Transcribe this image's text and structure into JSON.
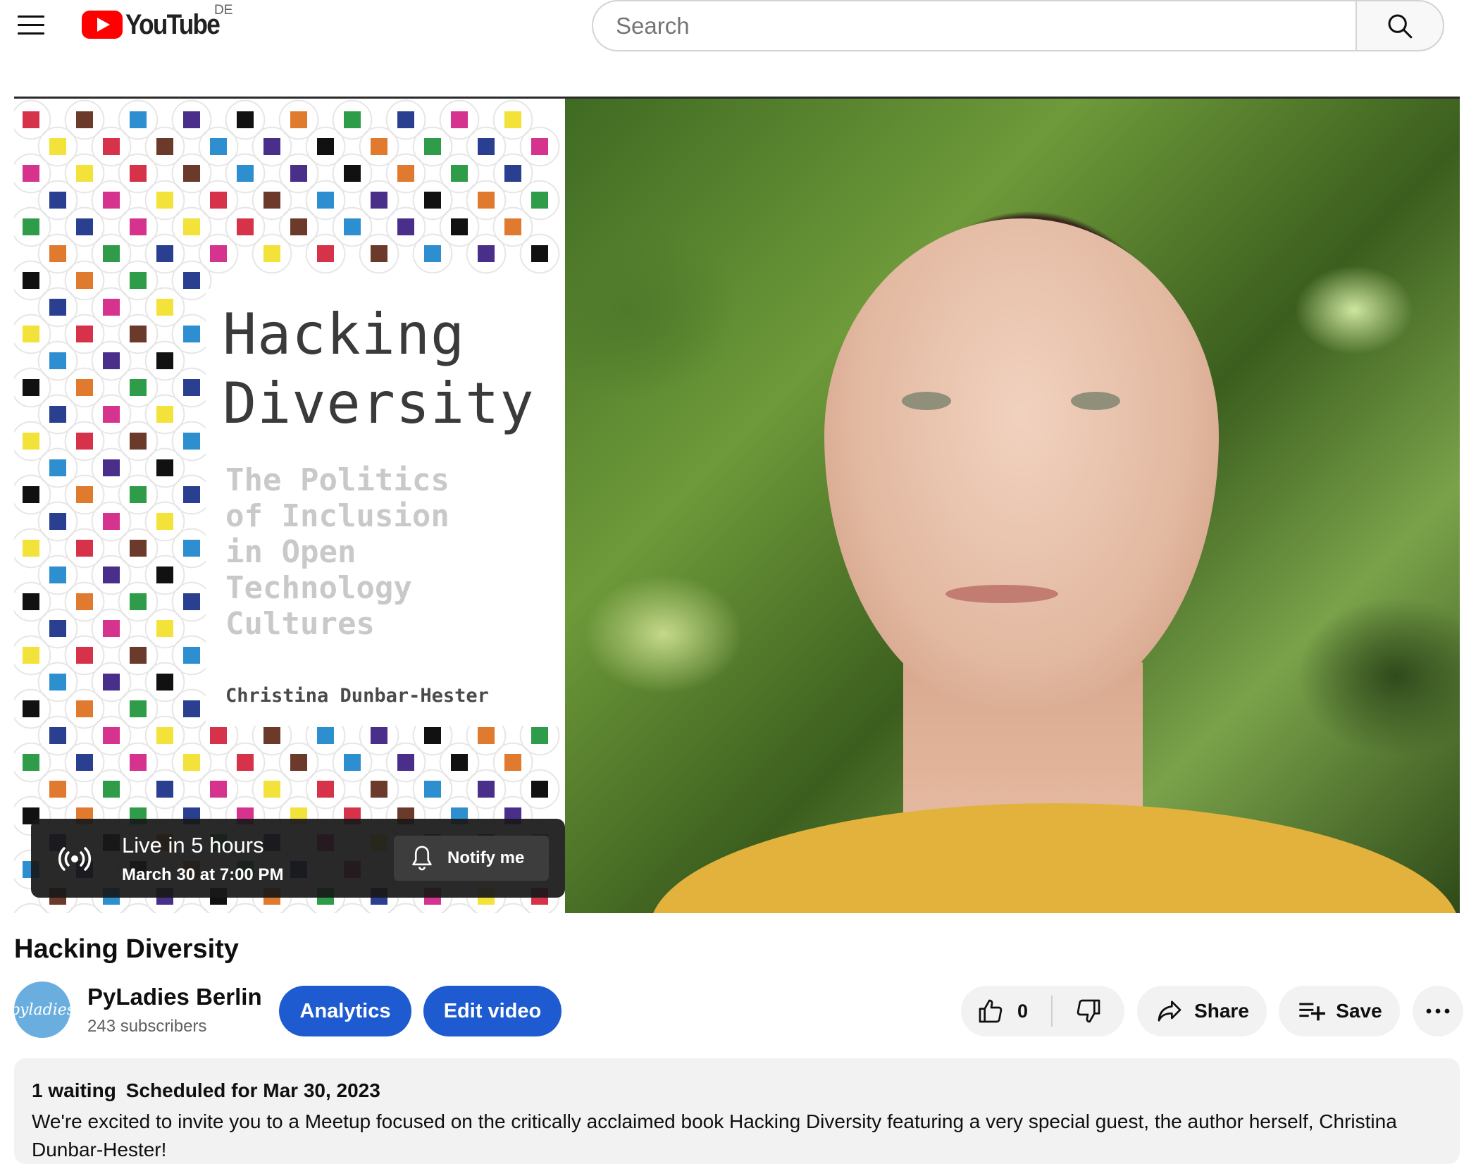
{
  "header": {
    "menu_icon": "hamburger-menu-icon",
    "logo_text": "YouTube",
    "country_code": "DE",
    "search_placeholder": "Search",
    "search_icon": "search-icon"
  },
  "player": {
    "cover": {
      "title_line1": "Hacking",
      "title_line2": "Diversity",
      "subtitle": "The Politics\nof Inclusion\nin Open\nTechnology\nCultures",
      "author": "Christina Dunbar-Hester"
    },
    "live": {
      "icon": "live-broadcast-icon",
      "title": "Live in 5 hours",
      "time": "March 30 at 7:00 PM",
      "notify_label": "Notify me",
      "notify_icon": "bell-icon"
    }
  },
  "video": {
    "title": "Hacking Diversity",
    "channel_name": "PyLadies Berlin",
    "channel_avatar_text": "pyladies",
    "subscribers": "243 subscribers",
    "analytics_label": "Analytics",
    "edit_label": "Edit video",
    "like_count": "0",
    "share_label": "Share",
    "save_label": "Save"
  },
  "description": {
    "waiting": "1 waiting",
    "scheduled": "Scheduled for Mar 30, 2023",
    "text": "We're excited to invite you to a Meetup focused on the critically acclaimed book Hacking Diversity featuring a very special guest, the author herself, Christina Dunbar-Hester!"
  },
  "colors": {
    "accent_blue": "#1f5bd0",
    "youtube_red": "#ff0000",
    "pill_gray": "#f2f2f2"
  }
}
